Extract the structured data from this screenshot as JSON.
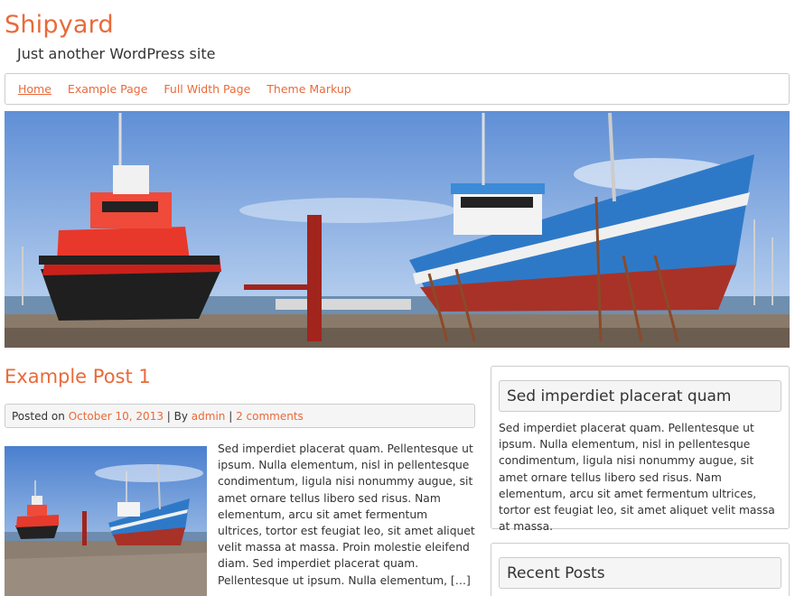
{
  "site": {
    "title": "Shipyard",
    "description": "Just another WordPress site"
  },
  "nav": {
    "items": [
      {
        "label": "Home",
        "current": true
      },
      {
        "label": "Example Page",
        "current": false
      },
      {
        "label": "Full Width Page",
        "current": false
      },
      {
        "label": "Theme Markup",
        "current": false
      }
    ]
  },
  "post": {
    "title": "Example Post 1",
    "meta": {
      "posted_on_label": "Posted on ",
      "date": "October 10, 2013",
      "separator1": " | By ",
      "author": "admin",
      "separator2": " | ",
      "comments": "2 comments"
    },
    "excerpt": "Sed imperdiet placerat quam. Pellentesque ut ipsum. Nulla elementum, nisl in pellentesque condimentum, ligula nisi nonummy augue, sit amet ornare tellus libero sed risus. Nam elementum, arcu sit amet fermentum ultrices, tortor est feugiat leo, sit amet aliquet velit massa at massa. Proin molestie eleifend diam. Sed imperdiet placerat quam. Pellentesque ut ipsum. Nulla elementum, […]"
  },
  "sidebar": {
    "widgets": [
      {
        "title": "Sed imperdiet placerat quam",
        "text": "Sed imperdiet placerat quam. Pellentesque ut ipsum. Nulla elementum, nisl in pellentesque condimentum, ligula nisi nonummy augue, sit amet ornare tellus libero sed risus. Nam elementum, arcu sit amet fermentum ultrices, tortor est feugiat leo, sit amet aliquet velit massa at massa."
      },
      {
        "title": "Recent Posts"
      }
    ]
  },
  "colors": {
    "accent": "#e96a3a",
    "border": "#cccccc",
    "meta_background": "#f5f5f5"
  }
}
